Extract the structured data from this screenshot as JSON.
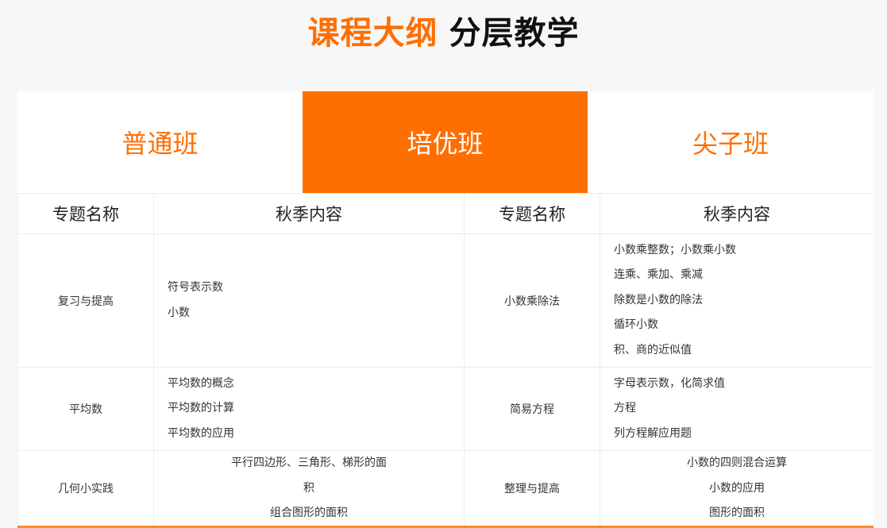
{
  "header": {
    "title_accent": "课程大纲",
    "title_main": "分层教学"
  },
  "tabs": [
    {
      "label": "普通班",
      "active": false
    },
    {
      "label": "培优班",
      "active": true
    },
    {
      "label": "尖子班",
      "active": false
    }
  ],
  "table": {
    "headers": [
      "专题名称",
      "秋季内容",
      "专题名称",
      "秋季内容"
    ],
    "rows": [
      {
        "topic_a": "复习与提高",
        "content_a": [
          "符号表示数",
          "小数"
        ],
        "topic_b": "小数乘除法",
        "content_b": [
          "小数乘整数；小数乘小数",
          "连乘、乘加、乘减",
          "除数是小数的除法",
          "循环小数",
          "积、商的近似值"
        ]
      },
      {
        "topic_a": "平均数",
        "content_a": [
          "平均数的概念",
          "平均数的计算",
          "平均数的应用"
        ],
        "topic_b": "简易方程",
        "content_b": [
          "字母表示数，化简求值",
          "方程",
          "列方程解应用题"
        ]
      },
      {
        "topic_a": "几何小实践",
        "content_a": [
          "平行四边形、三角形、梯形的面",
          "积",
          "组合图形的面积"
        ],
        "topic_b": "整理与提高",
        "content_b": [
          "小数的四则混合运算",
          "小数的应用",
          "图形的面积"
        ]
      }
    ]
  },
  "colors": {
    "accent": "#ff6e00",
    "background": "#f7f7f7"
  }
}
